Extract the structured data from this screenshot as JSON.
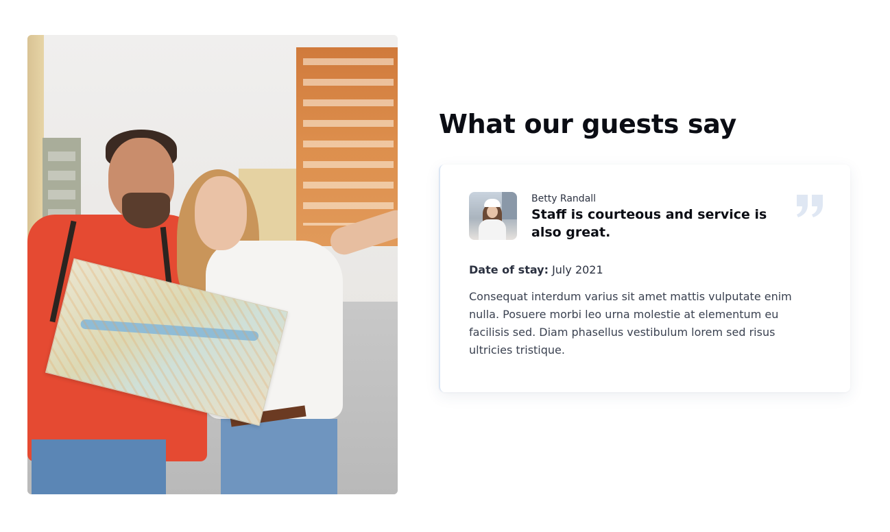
{
  "section": {
    "heading": "What our guests say"
  },
  "photo": {
    "alt": "Smiling couple of tourists holding a city map"
  },
  "testimonial": {
    "reviewer_name": "Betty Randall",
    "title": "Staff is courteous and service is also great.",
    "date_label": "Date of stay:",
    "date_value": "July 2021",
    "body": "Consequat interdum varius sit amet mattis vulputate enim nulla. Posuere morbi leo urna molestie at elementum eu facilisis sed. Diam phasellus vestibulum lorem sed risus ultricies tristique.",
    "quote_icon": "quote-icon",
    "quote_color": "#dfe7f3"
  },
  "colors": {
    "heading": "#0b0d14",
    "body_text": "#3a4150",
    "card_border": "#dbe6f4"
  }
}
